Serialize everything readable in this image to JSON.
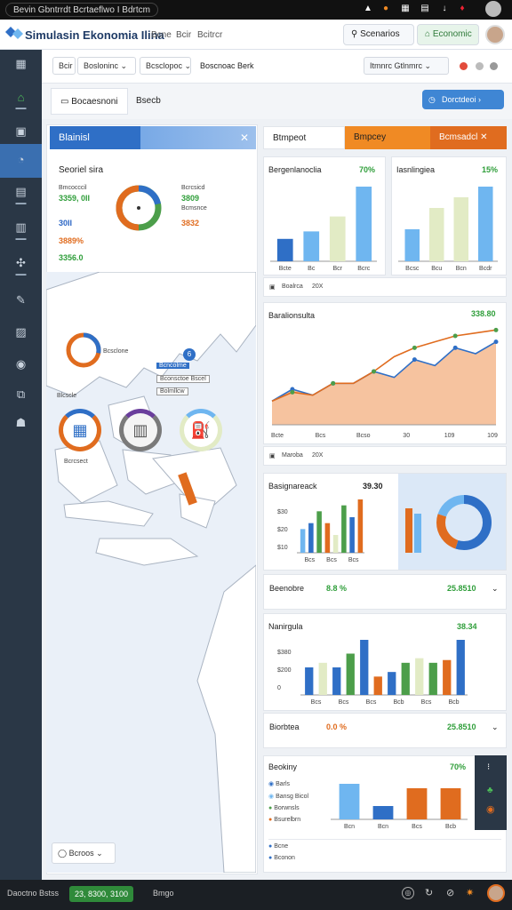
{
  "statusbar": {
    "title": "Bevin Gbntrrdt Bcrtaeflwo I Bdrtcm"
  },
  "app": {
    "title": "Simulasin Ekonomia Ilina",
    "menu": [
      "Bcne",
      "Bcir",
      "Bcitrcr"
    ],
    "pill_search": "Scenarios",
    "pill_green": "Economic"
  },
  "filters": {
    "f1": "Bcir",
    "f2": "Bosloninc",
    "f3": "Bcsclopoc",
    "f4": "Boscnoac Berk",
    "right_select": "Itmnrc Gtlnmrc"
  },
  "tabs": {
    "t1": "Bocaesnoni",
    "t2": "Bsecb",
    "action": "Dorctdeoi"
  },
  "left_panel": {
    "header": "Blainisl",
    "subtitle": "Seoriel sira",
    "stats_left": [
      {
        "label": "Bmcocccil",
        "value": "3359, 0II"
      },
      {
        "label": "",
        "value": "30II"
      },
      {
        "label": "",
        "value": "3889%"
      },
      {
        "label": "",
        "value": "3356.0"
      }
    ],
    "stats_right": [
      {
        "label": "Bcrcsicd",
        "value": "3809"
      },
      {
        "label": "",
        "value": "Bcmsnce"
      },
      {
        "label": "",
        "value": "3832"
      }
    ],
    "map_labels": {
      "m1": "Bcsclone",
      "m2": "Bcncolme",
      "m3": "Bconsctoe Bscel",
      "m4": "Bolmllcw",
      "m5": "Blcscle",
      "m6": "Bcrcsect"
    },
    "footer_select": "Bcroos"
  },
  "right_tabs": {
    "t1": "Btmpeot",
    "t2": "Bmpcey",
    "t3": "Bcmsadcl"
  },
  "chart_panels": {
    "p1_title": "Bergenlanoclia",
    "p1_pct": "70%",
    "p2_title": "Iasnlingiea",
    "p2_pct": "15%",
    "p1_footer": "Boalrca",
    "p1_footer_val": "20X",
    "p3_title": "Baralionsulta",
    "p3_value": "338.80",
    "p3_footer": "Maroba",
    "p3_footer_val": "20X",
    "p4_title": "Basignareack",
    "p4_value": "39.30",
    "p4_stats_label": "Beenobre",
    "p4_stats_a": "8.8 %",
    "p4_stats_b": "25.8510",
    "p5_title": "Nanirgula",
    "p5_value": "38.34",
    "p5_stats_label": "Biorbtea",
    "p5_stats_a": "0.0 %",
    "p5_stats_b": "25.8510",
    "p6_title": "Beokiny",
    "p6_pct": "70%",
    "p6_legend": [
      "Barls",
      "Bansg Bicol",
      "Borwnsls",
      "Bsurelbrn"
    ],
    "p6_foot": [
      "Bcne",
      "Bconon"
    ]
  },
  "bottombar": {
    "left": "Daoctno Bstss",
    "green": "23, 8300, 3100",
    "right": "Bmgo"
  },
  "colors": {
    "blue": "#2f6fc6",
    "light_blue": "#6fb6f0",
    "green": "#4c9e4a",
    "orange": "#e06c1f",
    "pale": "#e2ebc5"
  },
  "chart_data": [
    {
      "type": "bar",
      "title": "Bergenlanoclia",
      "categories": [
        "Bcte",
        "Bc",
        "Bcr",
        "Bcrc"
      ],
      "series": [
        {
          "values": [
            3,
            4,
            6,
            10
          ]
        }
      ]
    },
    {
      "type": "bar",
      "title": "Iasnlingiea",
      "categories": [
        "Bcsc",
        "Bcu",
        "Bcn",
        "Bcdr"
      ],
      "series": [
        {
          "values": [
            3,
            5,
            6,
            7
          ]
        }
      ]
    },
    {
      "type": "line",
      "title": "Baralionsulta",
      "x": [
        "Bcte",
        "Bcs",
        "Bcso",
        "30",
        "109",
        "109"
      ],
      "series": [
        {
          "values": [
            4,
            6,
            5,
            7,
            7,
            9,
            8,
            11,
            10,
            13,
            12,
            14
          ]
        },
        {
          "values": [
            4,
            5.5,
            5,
            7,
            7,
            9,
            11.5,
            13,
            14,
            15,
            15.5,
            16
          ]
        }
      ]
    },
    {
      "type": "bar",
      "title": "Basignareack",
      "categories": [
        "Bcs",
        "Bcs",
        "Bcs"
      ],
      "series": [
        {
          "values": [
            4,
            5,
            7,
            5,
            3,
            8,
            6,
            9
          ]
        }
      ]
    },
    {
      "type": "pie",
      "values": [
        55,
        25,
        20
      ]
    },
    {
      "type": "bar",
      "title": "Nanirgula",
      "categories": [
        "Bcs",
        "Bcs",
        "Bcs",
        "Bcb",
        "Bcs",
        "Bcb"
      ],
      "series": [
        {
          "values": [
            3,
            3.5,
            3,
            4.5,
            6,
            2,
            2.5,
            3.5,
            4,
            3.5,
            3.8,
            6
          ]
        }
      ]
    },
    {
      "type": "bar",
      "title": "Beokiny",
      "categories": [
        "Bcn",
        "Bcn",
        "Bcs",
        "Bcb"
      ],
      "series": [
        {
          "values": [
            8,
            3,
            7,
            7
          ]
        }
      ]
    }
  ]
}
